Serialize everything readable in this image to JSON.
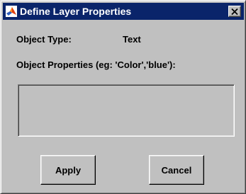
{
  "window": {
    "title": "Define Layer Properties",
    "title_icon": "matlab-logo-icon",
    "close_icon": "close-icon"
  },
  "form": {
    "object_type_label": "Object Type:",
    "object_type_value": "Text",
    "object_properties_label": "Object Properties (eg: 'Color','blue'):",
    "object_properties_value": ""
  },
  "buttons": {
    "apply_label": "Apply",
    "cancel_label": "Cancel"
  },
  "colors": {
    "titlebar": "#0a246a",
    "face": "#c0c0c0"
  }
}
